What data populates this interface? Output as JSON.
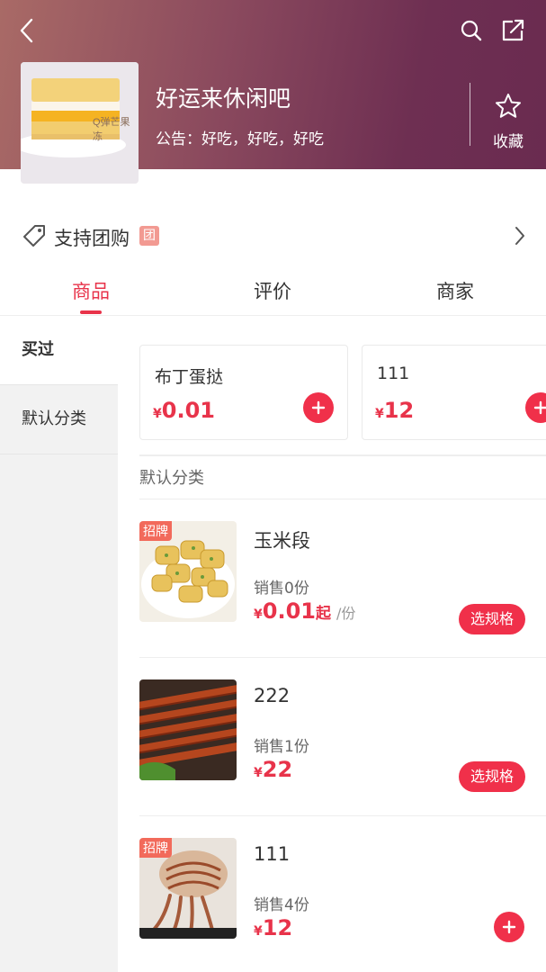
{
  "header": {
    "shop_name": "好运来休闲吧",
    "notice": "公告：好吃，好吃，好吃",
    "favorite_label": "收藏",
    "shop_image_caption": "Q弹芒果冻"
  },
  "group_buy": {
    "label": "支持团购",
    "tag": "团"
  },
  "tabs": [
    {
      "label": "商品",
      "active": true
    },
    {
      "label": "评价",
      "active": false
    },
    {
      "label": "商家",
      "active": false
    }
  ],
  "sidebar": {
    "items": [
      {
        "label": "买过"
      },
      {
        "label": "默认分类"
      }
    ]
  },
  "bought": [
    {
      "name": "布丁蛋挞",
      "currency": "¥",
      "price": "0.01"
    },
    {
      "name": "111",
      "currency": "¥",
      "price": "12"
    }
  ],
  "section": {
    "title": "默认分类"
  },
  "products": [
    {
      "name": "玉米段",
      "sales": "销售0份",
      "currency": "¥",
      "price": "0.01",
      "suffix": "起",
      "unit": "/份",
      "badge": "招牌",
      "action": "选规格"
    },
    {
      "name": "222",
      "sales": "销售1份",
      "currency": "¥",
      "price": "22",
      "suffix": "",
      "unit": "",
      "badge": "",
      "action": "选规格"
    },
    {
      "name": "111",
      "sales": "销售4份",
      "currency": "¥",
      "price": "12",
      "suffix": "",
      "unit": "",
      "badge": "招牌",
      "action": "add"
    }
  ],
  "colors": {
    "accent": "#e8334a",
    "button": "#f0304a",
    "badge": "#f26a5b",
    "sidebar_bg": "#f2f2f2"
  },
  "icons": [
    "back-arrow-icon",
    "search-icon",
    "share-icon",
    "star-icon",
    "tag-icon",
    "chevron-right-icon",
    "plus-icon"
  ]
}
